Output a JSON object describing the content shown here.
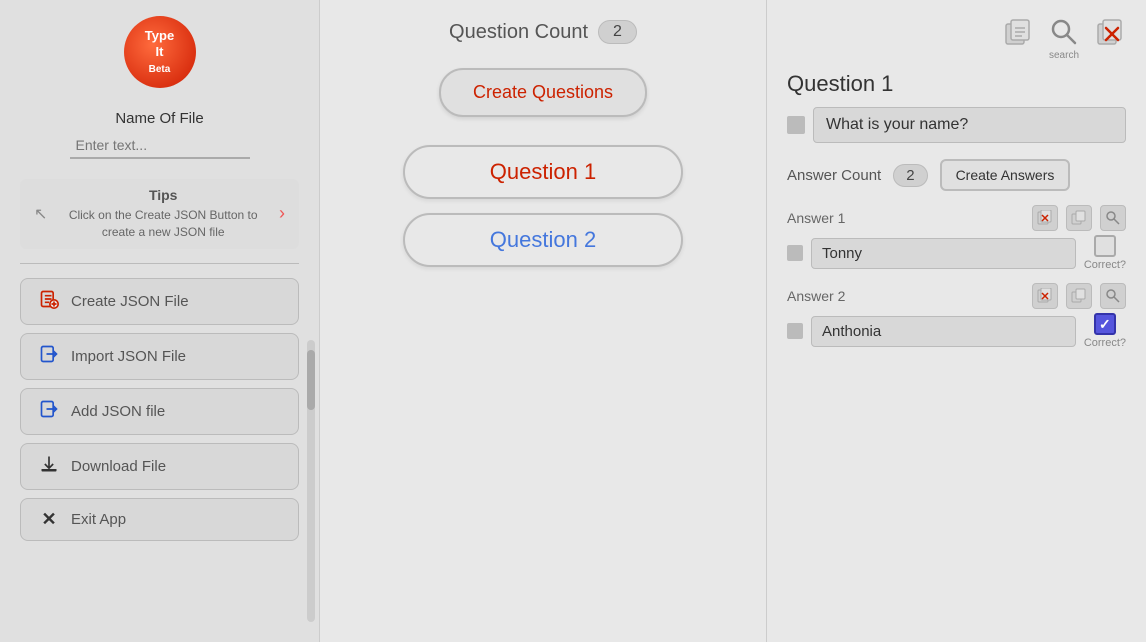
{
  "logo": {
    "line1": "Type",
    "line2": "It",
    "line3": "Beta"
  },
  "sidebar": {
    "name_of_file_label": "Name Of File",
    "name_input_placeholder": "Enter text...",
    "tips_title": "Tips",
    "tips_text": "Click on the Create JSON Button to create a new JSON file",
    "buttons": [
      {
        "id": "create-json",
        "label": "Create JSON File",
        "icon": "📄",
        "icon_class": "red"
      },
      {
        "id": "import-json",
        "label": "Import JSON File",
        "icon": "📥",
        "icon_class": "blue"
      },
      {
        "id": "add-json",
        "label": "Add JSON file",
        "icon": "📥",
        "icon_class": "blue"
      },
      {
        "id": "download",
        "label": "Download File",
        "icon": "⬇",
        "icon_class": "dark"
      },
      {
        "id": "exit",
        "label": "Exit App",
        "icon": "✕",
        "icon_class": "dark"
      }
    ]
  },
  "main": {
    "question_count_label": "Question Count",
    "question_count_value": "2",
    "create_questions_label": "Create Questions",
    "questions": [
      {
        "label": "Question 1"
      },
      {
        "label": "Question 2"
      }
    ]
  },
  "right_panel": {
    "top_icons": [
      {
        "id": "copy",
        "label": ""
      },
      {
        "id": "search",
        "label": "search"
      },
      {
        "id": "delete",
        "label": "delete"
      }
    ],
    "question_title": "Question 1",
    "question_text": "What is your name?",
    "answer_count_label": "Answer Count",
    "answer_count_value": "2",
    "create_answers_label": "Create Answers",
    "answers": [
      {
        "label": "Answer 1",
        "text": "Tonny",
        "correct": false,
        "correct_label": "Correct?"
      },
      {
        "label": "Answer 2",
        "text": "Anthonia",
        "correct": true,
        "correct_label": "Correct?"
      }
    ]
  }
}
